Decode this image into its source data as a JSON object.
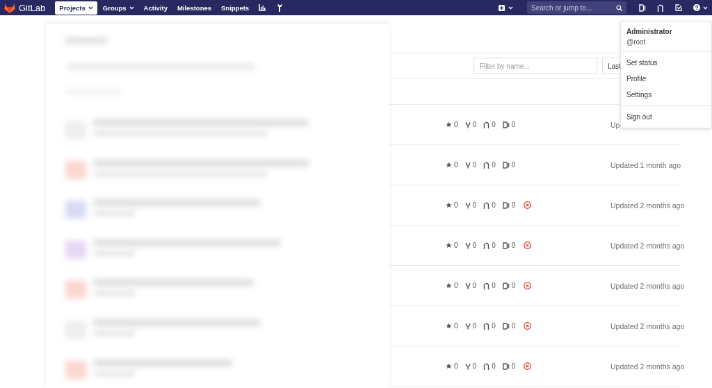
{
  "navbar": {
    "brand": "GitLab",
    "items": [
      {
        "label": "Projects",
        "selected": true,
        "dropdown": true
      },
      {
        "label": "Groups",
        "selected": false,
        "dropdown": true
      },
      {
        "label": "Activity",
        "selected": false,
        "dropdown": false
      },
      {
        "label": "Milestones",
        "selected": false,
        "dropdown": false
      },
      {
        "label": "Snippets",
        "selected": false,
        "dropdown": false
      }
    ],
    "search": {
      "placeholder": "Search or jump to..."
    }
  },
  "user_menu": {
    "name": "Administrator",
    "username": "@root",
    "sections": [
      [
        "Set status",
        "Profile",
        "Settings"
      ],
      [
        "Sign out"
      ]
    ]
  },
  "filter": {
    "placeholder": "Filter by name..."
  },
  "sort": {
    "label": "Last"
  },
  "projects": [
    {
      "star_count": "0",
      "fork_count": "0",
      "mr_count": "0",
      "issue_count": "0",
      "pipeline_failed": false,
      "updated": "Up"
    },
    {
      "star_count": "0",
      "fork_count": "0",
      "mr_count": "0",
      "issue_count": "0",
      "pipeline_failed": false,
      "updated": "Updated 1 month ago"
    },
    {
      "star_count": "0",
      "fork_count": "0",
      "mr_count": "0",
      "issue_count": "0",
      "pipeline_failed": true,
      "updated": "Updated 2 months ago"
    },
    {
      "star_count": "0",
      "fork_count": "0",
      "mr_count": "0",
      "issue_count": "0",
      "pipeline_failed": true,
      "updated": "Updated 2 months ago"
    },
    {
      "star_count": "0",
      "fork_count": "0",
      "mr_count": "0",
      "issue_count": "0",
      "pipeline_failed": true,
      "updated": "Updated 2 months ago"
    },
    {
      "star_count": "0",
      "fork_count": "0",
      "mr_count": "0",
      "issue_count": "0",
      "pipeline_failed": true,
      "updated": "Updated 2 months ago"
    },
    {
      "star_count": "0",
      "fork_count": "0",
      "mr_count": "0",
      "issue_count": "0",
      "pipeline_failed": true,
      "updated": "Updated 2 months ago"
    }
  ]
}
